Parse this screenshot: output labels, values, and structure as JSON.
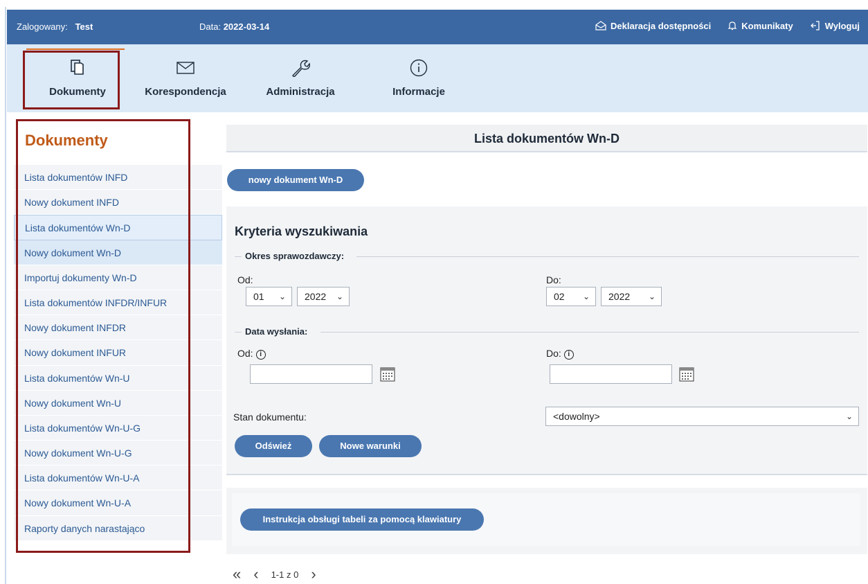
{
  "header": {
    "logged_label": "Zalogowany:",
    "logged_user": "Test",
    "date_label": "Data:",
    "date_value": "2022-03-14",
    "accessibility": "Deklaracja dostępności",
    "messages": "Komunikaty",
    "logout": "Wyloguj"
  },
  "tabs": [
    {
      "label": "Dokumenty",
      "icon": "documents-icon"
    },
    {
      "label": "Korespondencja",
      "icon": "envelope-icon"
    },
    {
      "label": "Administracja",
      "icon": "wrench-icon"
    },
    {
      "label": "Informacje",
      "icon": "info-icon"
    }
  ],
  "sidebar": {
    "title": "Dokumenty",
    "items": [
      {
        "label": "Lista dokumentów INFD"
      },
      {
        "label": "Nowy dokument INFD"
      },
      {
        "label": "Lista dokumentów Wn-D"
      },
      {
        "label": "Nowy dokument Wn-D"
      },
      {
        "label": "Importuj dokumenty Wn-D"
      },
      {
        "label": "Lista dokumentów INFDR/INFUR"
      },
      {
        "label": "Nowy dokument INFDR"
      },
      {
        "label": "Nowy dokument INFUR"
      },
      {
        "label": "Lista dokumentów Wn-U"
      },
      {
        "label": "Nowy dokument Wn-U"
      },
      {
        "label": "Lista dokumentów Wn-U-G"
      },
      {
        "label": "Nowy dokument Wn-U-G"
      },
      {
        "label": "Lista dokumentów Wn-U-A"
      },
      {
        "label": "Nowy dokument Wn-U-A"
      },
      {
        "label": "Raporty danych narastająco"
      }
    ]
  },
  "main": {
    "title": "Lista dokumentów Wn-D",
    "new_button": "nowy dokument Wn-D",
    "criteria": {
      "title": "Kryteria wyszukiwania",
      "period_legend": "Okres sprawozdawczy:",
      "from_label": "Od:",
      "to_label": "Do:",
      "from_month": "01",
      "from_year": "2022",
      "to_month": "02",
      "to_year": "2022",
      "sent_legend": "Data wysłania:",
      "sent_from_label": "Od:",
      "sent_to_label": "Do:",
      "sent_from_value": "",
      "sent_to_value": "",
      "status_label": "Stan dokumentu:",
      "status_value": "<dowolny>",
      "refresh_button": "Odśwież",
      "new_conditions_button": "Nowe warunki"
    },
    "instructions_button": "Instrukcja obsługi tabeli za pomocą klawiatury",
    "pager": {
      "range": "1-1 z 0"
    }
  },
  "colors": {
    "header_bg": "#3b68a3",
    "tabbar_bg": "#dce9f7",
    "accent_orange": "#c05a18",
    "button_bg": "#4a77b0",
    "highlight_frame": "#8b1a1a"
  }
}
